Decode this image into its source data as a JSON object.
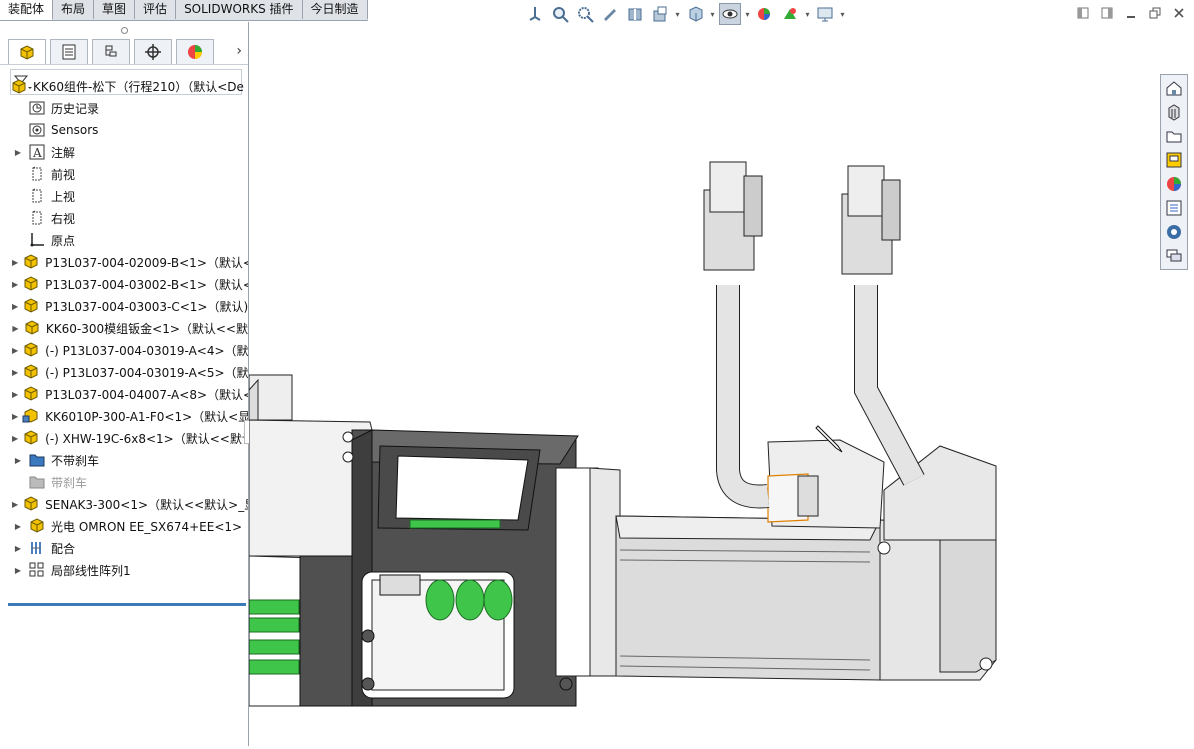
{
  "tabs": [
    "装配体",
    "布局",
    "草图",
    "评估",
    "SOLIDWORKS 插件",
    "今日制造"
  ],
  "view_toolbar": {
    "icons": [
      "view-orientation-icon",
      "zoom-to-fit-icon",
      "zoom-area-icon",
      "previous-view-icon",
      "section-view-icon",
      "dynamic-annotation-icon",
      "view-orientation-cube-icon",
      "display-style-icon",
      "hide-show-icon",
      "edit-appearance-icon",
      "apply-scene-icon",
      "view-settings-icon"
    ]
  },
  "window_controls": [
    "tile-left-icon",
    "tile-right-icon",
    "minimize-icon",
    "restore-icon",
    "close-icon"
  ],
  "feature_tree": {
    "root": "KK60组件-松下（行程210）（默认<De",
    "items": [
      {
        "label": "历史记录",
        "icon": "history-icon",
        "expandable": false
      },
      {
        "label": "Sensors",
        "icon": "sensors-icon",
        "expandable": false
      },
      {
        "label": "注解",
        "icon": "annotations-icon",
        "expandable": true
      },
      {
        "label": "前视",
        "icon": "plane-icon",
        "expandable": false
      },
      {
        "label": "上视",
        "icon": "plane-icon",
        "expandable": false
      },
      {
        "label": "右视",
        "icon": "plane-icon",
        "expandable": false
      },
      {
        "label": "原点",
        "icon": "origin-icon",
        "expandable": false
      },
      {
        "label": "P13L037-004-02009-B<1>（默认<",
        "icon": "part-icon",
        "expandable": true
      },
      {
        "label": "P13L037-004-03002-B<1>（默认<",
        "icon": "part-icon",
        "expandable": true
      },
      {
        "label": "P13L037-004-03003-C<1>（默认)",
        "icon": "part-icon",
        "expandable": true
      },
      {
        "label": "KK60-300模组钣金<1>（默认<<默",
        "icon": "part-icon",
        "expandable": true
      },
      {
        "label": "(-) P13L037-004-03019-A<4>（默",
        "icon": "part-icon",
        "expandable": true
      },
      {
        "label": "(-) P13L037-004-03019-A<5>（默",
        "icon": "part-icon",
        "expandable": true
      },
      {
        "label": "P13L037-004-04007-A<8>（默认<",
        "icon": "part-icon",
        "expandable": true
      },
      {
        "label": "KK6010P-300-A1-F0<1>（默认<显",
        "icon": "subassembly-icon",
        "expandable": true
      },
      {
        "label": "(-) XHW-19C-6x8<1>（默认<<默认",
        "icon": "part-icon",
        "expandable": true
      },
      {
        "label": "不带刹车",
        "icon": "folder-icon",
        "expandable": true
      },
      {
        "label": "带刹车",
        "icon": "folder-gray-icon",
        "expandable": false,
        "gray": true
      },
      {
        "label": "SENAK3-300<1>（默认<<默认>_显",
        "icon": "part-icon",
        "expandable": true
      },
      {
        "label": "光电 OMRON EE_SX674+EE<1>",
        "icon": "part-icon",
        "expandable": true
      },
      {
        "label": "配合",
        "icon": "mates-icon",
        "expandable": true
      },
      {
        "label": "局部线性阵列1",
        "icon": "pattern-icon",
        "expandable": true
      }
    ]
  },
  "task_pane": [
    "home-icon",
    "design-library-icon",
    "file-explorer-icon",
    "view-palette-icon",
    "appearances-icon",
    "custom-properties-icon",
    "solidworks-resources-icon",
    "forum-icon"
  ]
}
